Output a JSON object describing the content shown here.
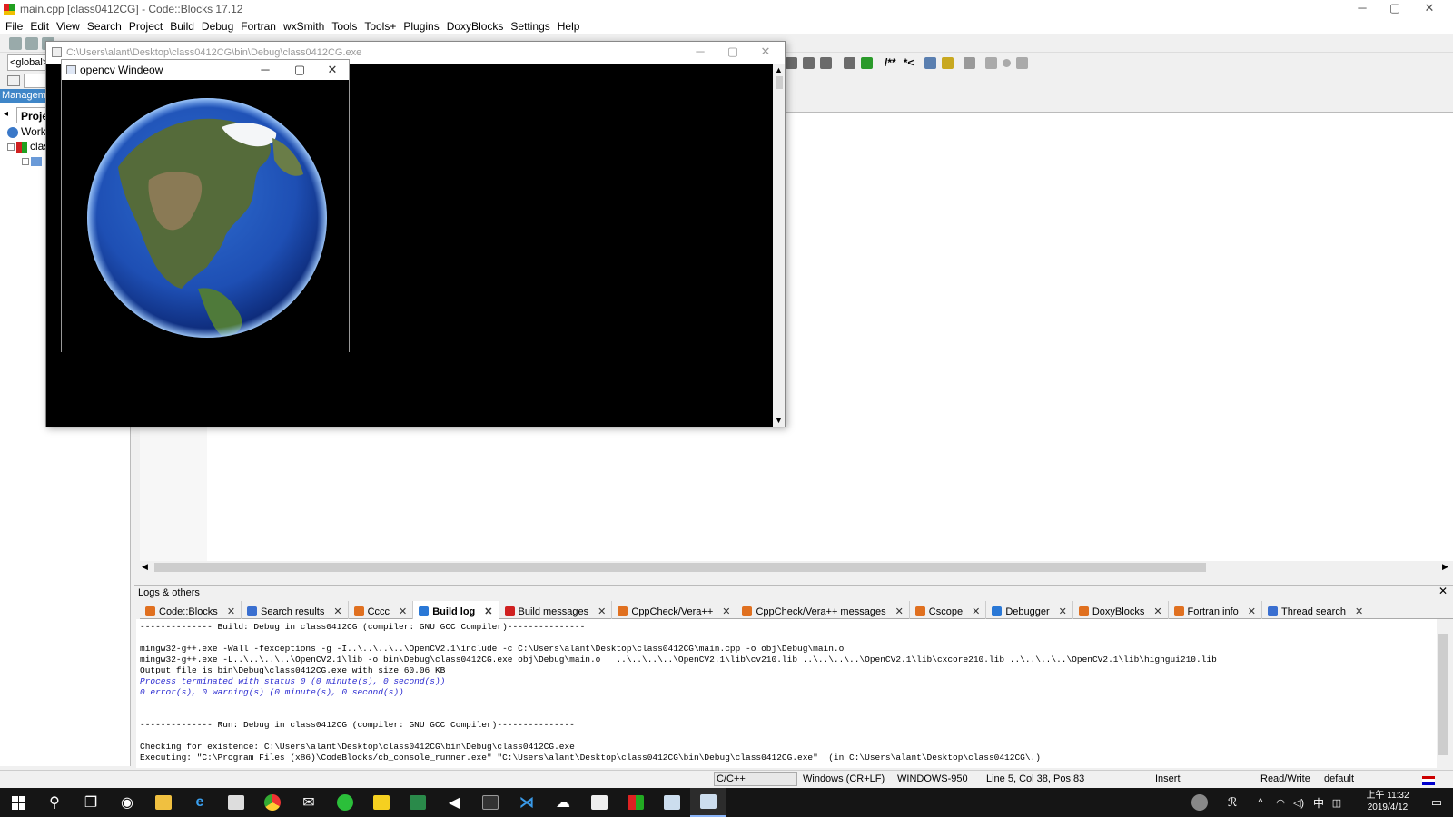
{
  "window": {
    "title": "main.cpp [class0412CG] - Code::Blocks 17.12",
    "minimize": "─",
    "maximize": "▢",
    "close": "✕"
  },
  "menu": [
    "File",
    "Edit",
    "View",
    "Search",
    "Project",
    "Build",
    "Debug",
    "Fortran",
    "wxSmith",
    "Tools",
    "Tools+",
    "Plugins",
    "DoxyBlocks",
    "Settings",
    "Help"
  ],
  "toolbar": {
    "scope_combo": "<global>",
    "doxy_comment": "/**",
    "doxy_line": "*<"
  },
  "management": {
    "header": "Management",
    "tab": "Projects",
    "tree": [
      {
        "label": "Workspace"
      },
      {
        "label": "class0412CG"
      }
    ]
  },
  "console_window": {
    "title": "C:\\Users\\alant\\Desktop\\class0412CG\\bin\\Debug\\class0412CG.exe"
  },
  "cv_window": {
    "title": "opencv Windeow"
  },
  "logs": {
    "title": "Logs & others",
    "close": "✕",
    "tabs": [
      {
        "label": "Code::Blocks",
        "icon_color": "#e07020",
        "active": false
      },
      {
        "label": "Search results",
        "icon_color": "#3a6fd0",
        "active": false
      },
      {
        "label": "Cccc",
        "icon_color": "#e07020",
        "active": false
      },
      {
        "label": "Build log",
        "icon_color": "#2a78d6",
        "active": true
      },
      {
        "label": "Build messages",
        "icon_color": "#d02020",
        "active": false
      },
      {
        "label": "CppCheck/Vera++",
        "icon_color": "#e07020",
        "active": false
      },
      {
        "label": "CppCheck/Vera++ messages",
        "icon_color": "#e07020",
        "active": false
      },
      {
        "label": "Cscope",
        "icon_color": "#e07020",
        "active": false
      },
      {
        "label": "Debugger",
        "icon_color": "#2a78d6",
        "active": false
      },
      {
        "label": "DoxyBlocks",
        "icon_color": "#e07020",
        "active": false
      },
      {
        "label": "Fortran info",
        "icon_color": "#e07020",
        "active": false
      },
      {
        "label": "Thread search",
        "icon_color": "#3a6fd0",
        "active": false
      }
    ],
    "lines": [
      {
        "text": "-------------- Build: Debug in class0412CG (compiler: GNU GCC Compiler)---------------",
        "italic": false
      },
      {
        "text": "",
        "italic": false
      },
      {
        "text": "mingw32-g++.exe -Wall -fexceptions -g -I..\\..\\..\\..\\OpenCV2.1\\include -c C:\\Users\\alant\\Desktop\\class0412CG\\main.cpp -o obj\\Debug\\main.o",
        "italic": false
      },
      {
        "text": "mingw32-g++.exe -L..\\..\\..\\..\\OpenCV2.1\\lib -o bin\\Debug\\class0412CG.exe obj\\Debug\\main.o   ..\\..\\..\\..\\OpenCV2.1\\lib\\cv210.lib ..\\..\\..\\..\\OpenCV2.1\\lib\\cxcore210.lib ..\\..\\..\\..\\OpenCV2.1\\lib\\highgui210.lib",
        "italic": false
      },
      {
        "text": "Output file is bin\\Debug\\class0412CG.exe with size 60.06 KB",
        "italic": false
      },
      {
        "text": "Process terminated with status 0 (0 minute(s), 0 second(s))",
        "italic": true
      },
      {
        "text": "0 error(s), 0 warning(s) (0 minute(s), 0 second(s))",
        "italic": true
      },
      {
        "text": "",
        "italic": false
      },
      {
        "text": "",
        "italic": false
      },
      {
        "text": "-------------- Run: Debug in class0412CG (compiler: GNU GCC Compiler)---------------",
        "italic": false
      },
      {
        "text": "",
        "italic": false
      },
      {
        "text": "Checking for existence: C:\\Users\\alant\\Desktop\\class0412CG\\bin\\Debug\\class0412CG.exe",
        "italic": false
      },
      {
        "text": "Executing: \"C:\\Program Files (x86)\\CodeBlocks/cb_console_runner.exe\" \"C:\\Users\\alant\\Desktop\\class0412CG\\bin\\Debug\\class0412CG.exe\"  (in C:\\Users\\alant\\Desktop\\class0412CG\\.)",
        "italic": false
      }
    ]
  },
  "statusbar": {
    "language": "C/C++",
    "line_endings": "Windows (CR+LF)",
    "encoding": "WINDOWS-950",
    "position": "Line 5, Col 38, Pos 83",
    "mode": "Insert",
    "access": "Read/Write",
    "profile": "default"
  },
  "taskbar": {
    "clock_time": "上午 11:32",
    "clock_date": "2019/4/12",
    "ime": "中",
    "icons": [
      "windows-start-icon",
      "search-icon",
      "task-view-icon",
      "steam-icon",
      "file-explorer-icon",
      "edge-icon",
      "store-icon",
      "chrome-icon",
      "mail-icon",
      "line-icon",
      "sticky-notes-icon",
      "excel-icon",
      "media-icon",
      "terminal-icon",
      "vscode-icon",
      "remote-icon",
      "photos-icon",
      "codeblocks-icon",
      "app-icon",
      "console-app-icon"
    ]
  },
  "colors": {
    "accent": "#3f86c8",
    "log_italic": "#2a2ad0",
    "taskbar": "#151515"
  }
}
